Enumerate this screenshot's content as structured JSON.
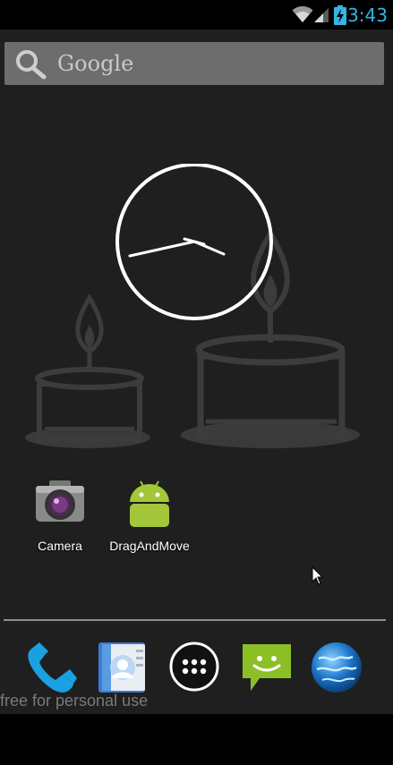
{
  "status_bar": {
    "time": "3:43",
    "icons": [
      "wifi-icon",
      "cell-signal-icon",
      "battery-charging-icon"
    ],
    "time_color": "#33b5e5"
  },
  "search_bar": {
    "label": "Google",
    "icon": "search-icon"
  },
  "clock_widget": {
    "type": "analog-clock"
  },
  "apps": [
    {
      "label": "Camera",
      "icon": "camera-icon"
    },
    {
      "label": "DragAndMove",
      "icon": "android-icon"
    }
  ],
  "dock": {
    "items": [
      "phone-icon",
      "contacts-icon",
      "all-apps-icon",
      "messaging-icon",
      "browser-icon"
    ]
  },
  "watermark": "free for personal use",
  "wallpaper": {
    "theme": "candle-cakes",
    "background_color": "#1f1f1f"
  }
}
